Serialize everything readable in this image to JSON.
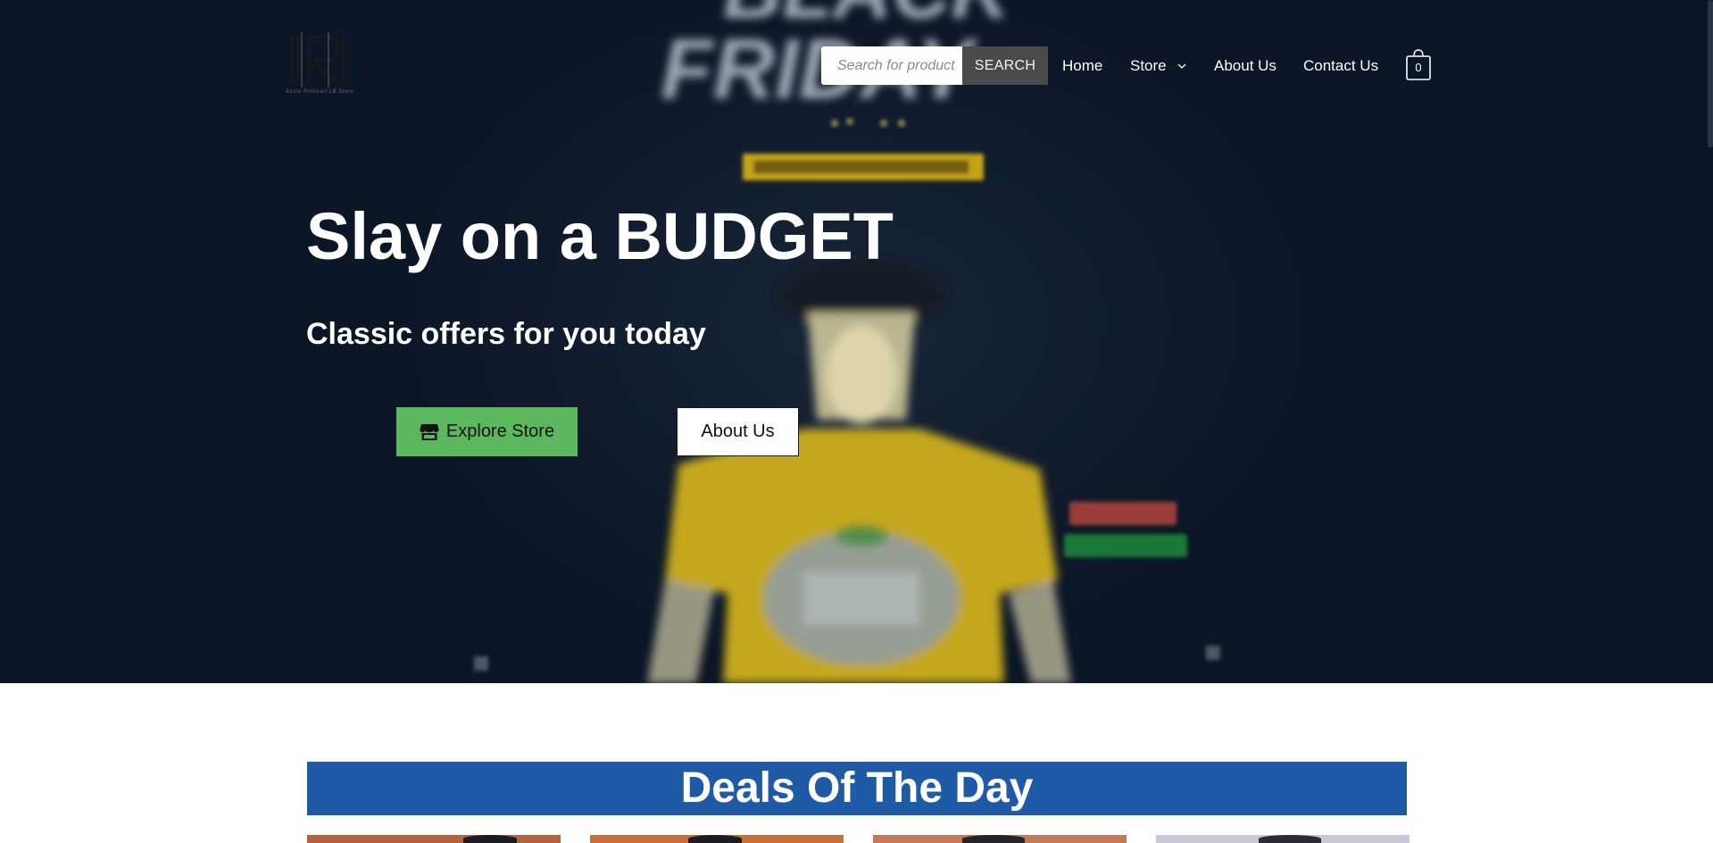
{
  "header": {
    "logo_text": "Azure Rinheart LB Store",
    "search": {
      "placeholder": "Search for products",
      "button_label": "SEARCH"
    },
    "nav": [
      {
        "label": "Home"
      },
      {
        "label": "Store"
      },
      {
        "label": "About Us"
      },
      {
        "label": "Contact Us"
      }
    ],
    "cart_count": "0"
  },
  "hero": {
    "title": "Slay on a BUDGET",
    "subtitle": "Classic offers for you today",
    "primary_button": "Explore Store",
    "secondary_button": "About Us",
    "background_text": [
      "BLACK",
      "FRIDAY"
    ]
  },
  "deals": {
    "title": "Deals Of The Day"
  },
  "colors": {
    "hero_bg": "#0b1626",
    "explore_button": "#5cb85c",
    "deals_banner": "#1f5aa6",
    "search_button": "#4a4a4a"
  },
  "icons": {
    "store_button_icon": "store-icon",
    "nav_dropdown": "chevron-down-icon",
    "cart": "shopping-bag-icon"
  }
}
